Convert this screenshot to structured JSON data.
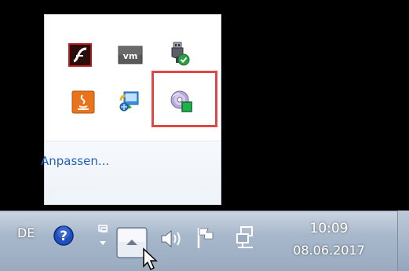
{
  "tray_popup": {
    "customize_label": "Anpassen...",
    "icons": [
      {
        "name": "adobe-flash-icon",
        "color": "#c62828"
      },
      {
        "name": "vmware-icon",
        "color": "#4d4d4d"
      },
      {
        "name": "usb-safe-remove-icon",
        "color": "#3aa835"
      },
      {
        "name": "java-icon",
        "color": "#e8731a"
      },
      {
        "name": "windows-network-icon",
        "color": "#2f7fd6"
      },
      {
        "name": "media-disc-icon",
        "color": "#21b14a"
      }
    ],
    "highlight_color": "#e04848"
  },
  "taskbar": {
    "language": "DE",
    "clock": {
      "time": "10:09",
      "date": "08.06.2017"
    },
    "icons": [
      "help-icon",
      "network-small-icon",
      "show-hidden-icons-button",
      "volume-icon",
      "action-center-flag-icon",
      "network-icon"
    ]
  }
}
